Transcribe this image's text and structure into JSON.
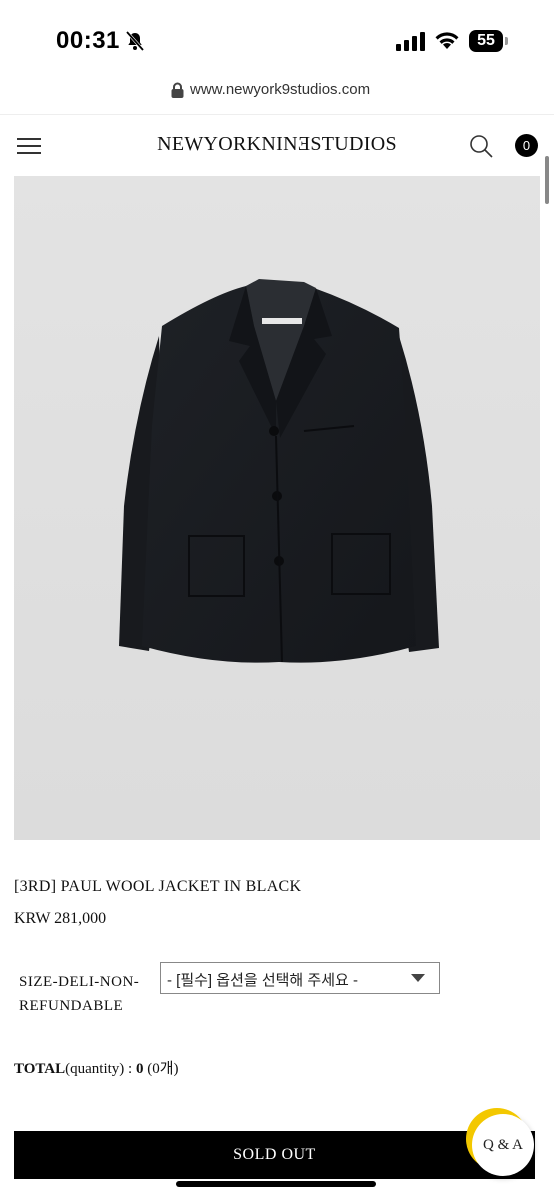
{
  "status_bar": {
    "time": "00:31",
    "battery": "55"
  },
  "url_bar": {
    "url": "www.newyork9studios.com"
  },
  "header": {
    "brand": "NEWYORKNINƎSTUDIOS",
    "cart_count": "0"
  },
  "product": {
    "name": "[3RD] PAUL WOOL JACKET IN BLACK",
    "price": "KRW 281,000",
    "option_label_line1": "SIZE-DELI-NON-",
    "option_label_line2": "REFUNDABLE",
    "option_placeholder": "- [필수] 옵션을 선택해 주세요 -",
    "total_label": "TOTAL",
    "total_qty_label": "(quantity) : ",
    "total_value": "0",
    "total_count": " (0개)"
  },
  "actions": {
    "sold_out": "SOLD OUT",
    "qa": "Q & A"
  },
  "colors": {
    "accent": "#f3c800",
    "button": "#000000",
    "image_bg": "#dfdfdf"
  }
}
